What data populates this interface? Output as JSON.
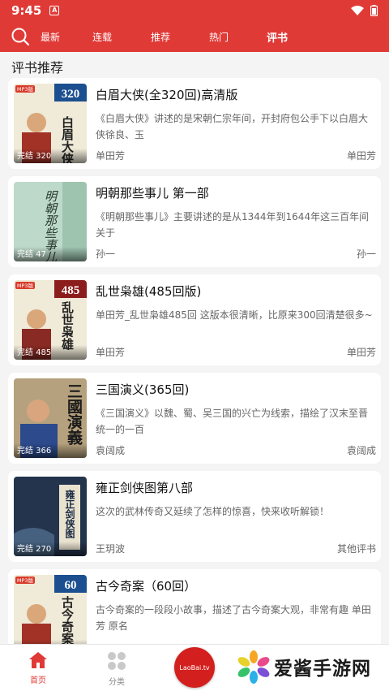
{
  "status_bar": {
    "time": "9:45",
    "notification_glyph": "A"
  },
  "top_nav": {
    "tabs": [
      "最新",
      "连载",
      "推荐",
      "热门",
      "评书"
    ],
    "active_tab": "评书"
  },
  "section_title": "评书推荐",
  "books": [
    {
      "title": "白眉大侠(全320回)高清版",
      "description": "《白眉大侠》讲述的是宋朝仁宗年间，开封府包公手下以白眉大侠徐良、玉",
      "author": "单田芳",
      "source": "单田芳",
      "badge": "完结 320",
      "cover_number": "320",
      "cover_text": "白眉大侠",
      "cover_tag": "MP3版"
    },
    {
      "title": "明朝那些事儿 第一部",
      "description": "《明朝那些事儿》主要讲述的是从1344年到1644年这三百年间关于",
      "author": "孙一",
      "source": "孙一",
      "badge": "完结 47",
      "cover_text": "明朝那些事儿"
    },
    {
      "title": "乱世枭雄(485回版)",
      "description": "单田芳_乱世枭雄485回 这版本很清晰，比原来300回清楚很多~",
      "author": "单田芳",
      "source": "单田芳",
      "badge": "完结 485",
      "cover_number": "485",
      "cover_text": "乱世枭雄",
      "cover_tag": "MP3版"
    },
    {
      "title": "三国演义(365回)",
      "description": "《三国演义》以魏、蜀、吴三国的兴亡为线索，描绘了汉末至晋统一的一百",
      "author": "袁阔成",
      "source": "袁阔成",
      "badge": "完结 366",
      "cover_text": "三國演義"
    },
    {
      "title": "雍正剑侠图第八部",
      "description": "这次的武林传奇又延续了怎样的惊喜，快来收听解锁！",
      "author": "王玥波",
      "source": "其他评书",
      "badge": "完结 270",
      "cover_text": "雍正剑侠图"
    },
    {
      "title": "古今奇案（60回）",
      "description": "古今奇案的一段段小故事，描述了古今奇案大观，非常有趣 单田芳 原名",
      "author": "",
      "source": "",
      "badge": "",
      "cover_number": "60",
      "cover_text": "古今奇案",
      "cover_tag": "MP3版"
    }
  ],
  "bottom_nav": {
    "home_label": "首页",
    "category_label": "分类",
    "center_logo_text": "LaoBai.tv"
  },
  "watermark": {
    "text": "爱酱手游网"
  },
  "colors": {
    "brand_red": "#e03a37",
    "card_bg": "#ffffff",
    "page_bg": "#f4f4f4"
  }
}
